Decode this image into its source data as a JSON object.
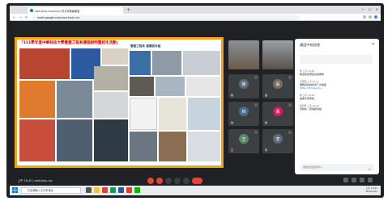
{
  "browser": {
    "tab_title": "cwd-kmju-cwd-kmju 的共享螢幕畫面",
    "new_tab": "+",
    "url": "meet.google.com/cwd-kmju-rvz",
    "window_controls": [
      "—",
      "☐",
      "✕"
    ]
  },
  "slide": {
    "title": "「111學年度中華科技大學營建工程系課程說明暨招生活動」",
    "subtitle": "營建工程系 建築設計組"
  },
  "participants": [
    {
      "name": "",
      "initial": "",
      "color": "#6b5b4a"
    },
    {
      "name": "",
      "initial": "",
      "color": "#5a5048"
    },
    {
      "name": "陳",
      "initial": "陳",
      "color": "#5f6b7a"
    },
    {
      "name": "張",
      "initial": "張",
      "color": "#7a6b5f"
    },
    {
      "name": "林",
      "initial": "林",
      "color": "#4a6b8a"
    },
    {
      "name": "黃",
      "initial": "黃",
      "color": "#d81b60"
    },
    {
      "name": "王",
      "initial": "王",
      "color": "#5b8a6b"
    },
    {
      "name": "李",
      "initial": "李",
      "color": "#5f6b7a"
    }
  ],
  "chat": {
    "header": "通話中的訊息",
    "close": "✕",
    "input_placeholder": "傳送訊息給所有人",
    "send_icon": "send-icon",
    "messages": [
      {
        "who": "你  上午 10:36",
        "text": "歡迎參加營建系說明會",
        "link": ""
      },
      {
        "who": "王老師  上午 10:37",
        "text": "課程資料請參考下方連結",
        "link": "https://forms.gle/..."
      },
      {
        "who": "你  上午 10:39",
        "text": "謝謝大家參與",
        "link": ""
      },
      {
        "who": "林同學  上午 10:40",
        "text": "老師好，聽得很清楚",
        "link": ""
      }
    ]
  },
  "meeting": {
    "time_code": "上午 10:42  |  cwd-kmju-rvz"
  },
  "taskbar": {
    "search_placeholder": "在這裡輸入文字來搜尋",
    "clock_time": "上午 10:42",
    "clock_date": "2022/4/20"
  },
  "colors": {
    "presentation_border": "#f3a21c",
    "meet_bg": "#202124",
    "end_call": "#ea4335"
  }
}
